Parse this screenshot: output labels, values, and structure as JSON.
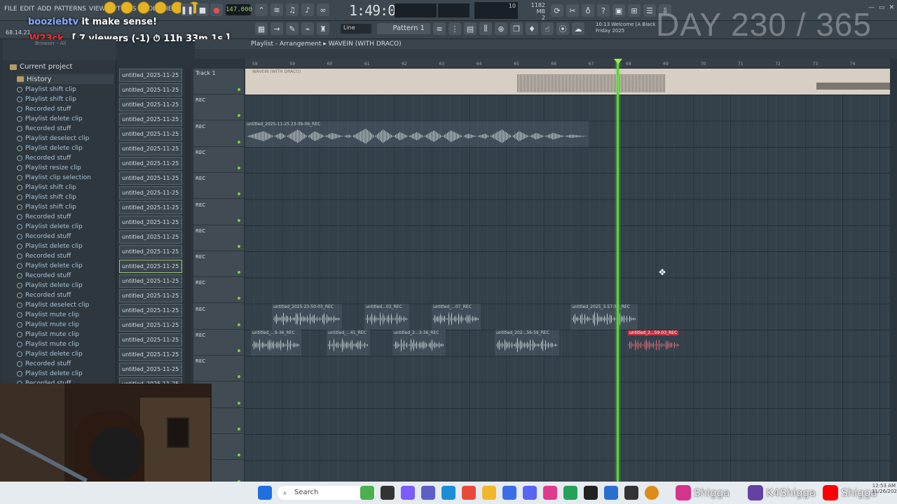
{
  "menu": [
    "FILE",
    "EDIT",
    "ADD",
    "PATTERNS",
    "VIEW",
    "OPTIONS",
    "TOOLS",
    "HELP"
  ],
  "tempo": "147.000",
  "song_time": "1:49:02",
  "cpu": {
    "value": "10",
    "poly": "2"
  },
  "memory": {
    "mb": "1182 MB",
    "poly": "2"
  },
  "hint_bar": {
    "time": "10:13",
    "text": "Welcome [A Black",
    "day": "Friday 2025"
  },
  "day_overlay": "DAY 230 / 365",
  "chat": [
    {
      "user": "booziebtv",
      "message": "it make sense!"
    },
    {
      "user": "W23ck",
      "message": "【 7 viewers (-1) ⏱ 11h 33m 1s 】"
    }
  ],
  "timestamp": "68.14.21",
  "toolbar2": {
    "snap": "Line",
    "pattern": "Pattern 1"
  },
  "browser": {
    "label": "Browser - All",
    "current_project": "Current project",
    "history_label": "History",
    "history": [
      "Playlist shift clip",
      "Playlist shift clip",
      "Recorded stuff",
      "Playlist delete clip",
      "Recorded stuff",
      "Playlist deselect clip",
      "Playlist delete clip",
      "Recorded stuff",
      "Playlist resize clip",
      "Playlist clip selection",
      "Playlist shift clip",
      "Playlist shift clip",
      "Playlist shift clip",
      "Recorded stuff",
      "Playlist delete clip",
      "Recorded stuff",
      "Playlist delete clip",
      "Recorded stuff",
      "Playlist delete clip",
      "Recorded stuff",
      "Playlist delete clip",
      "Recorded stuff",
      "Playlist deselect clip",
      "Playlist mute clip",
      "Playlist mute clip",
      "Playlist mute clip",
      "Playlist mute clip",
      "Playlist delete clip",
      "Recorded stuff",
      "Playlist delete clip",
      "Recorded stuff"
    ]
  },
  "clip_list": {
    "items": [
      "untitled_2025-11-25 23-",
      "untitled_2025-11-25 23-",
      "untitled_2025-11-25 23-",
      "untitled_2025-11-25 23-",
      "untitled_2025-11-25 23-",
      "untitled_2025-11-25 23-",
      "untitled_2025-11-25 23-",
      "untitled_2025-11-25 23-",
      "untitled_2025-11-25 23-",
      "untitled_2025-11-25 23-",
      "untitled_2025-11-25 23-",
      "untitled_2025-11-25 23-",
      "untitled_2025-11-25 23-",
      "untitled_2025-11-25 23-",
      "untitled_2025-11-25 23-",
      "untitled_2025-11-25 23-",
      "untitled_2025-11-25 23-",
      "untitled_2025-11-25 23-",
      "untitled_2025-11-25 23-",
      "untitled_2025-11-25 23-",
      "untitled_2025-11-25 23-",
      "untitled_2025-11-25 23-",
      "untitled_2025-11-25 23-"
    ],
    "selected_index": 13
  },
  "playlist": {
    "title": "Playlist - Arrangement",
    "arrangement": "WAVEIN (WITH DRACO)",
    "timeline": [
      "58",
      "59",
      "60",
      "61",
      "62",
      "63",
      "64",
      "65",
      "66",
      "67",
      "68",
      "69",
      "70",
      "71",
      "72",
      "73",
      "74"
    ],
    "tracks": [
      "Track 1",
      "REC",
      "REC",
      "REC",
      "REC",
      "REC",
      "REC",
      "REC",
      "REC",
      "REC",
      "REC",
      "REC",
      "REC",
      "REC",
      "REC",
      "REC"
    ],
    "master_clip_label": "WAVEIN (WITH DRACO)",
    "clips": [
      {
        "row": 2,
        "label": "untitled_2025-11-25 23-39-06_REC"
      },
      {
        "row": 9,
        "label": "untitled_2025-23-50-03_REC"
      },
      {
        "row": 9,
        "label": "untitled...03_REC"
      },
      {
        "row": 9,
        "label": "untitled_...07_REC"
      },
      {
        "row": 9,
        "label": "untitled_2025_3-57-53_REC"
      },
      {
        "row": 10,
        "label": "untitled_...9-36_REC"
      },
      {
        "row": 10,
        "label": "untitled_...41_REC"
      },
      {
        "row": 10,
        "label": "untitled_2...3-36_REC"
      },
      {
        "row": 10,
        "label": "untitled_202...56-59_REC"
      },
      {
        "row": 10,
        "label": "untitled_2...59-03_REC",
        "selected": true
      }
    ]
  },
  "taskbar": {
    "search_placeholder": "Search",
    "clock": "12:53 AM",
    "date": "11/26/2025"
  },
  "socials": [
    {
      "platform": "instagram-icon",
      "handle": "Shigga"
    },
    {
      "platform": "twitch-icon",
      "handle": "K4Shigga"
    },
    {
      "platform": "youtube-icon",
      "handle": "Shigga"
    }
  ],
  "colors": {
    "playhead": "#5fd43a",
    "selected_clip": "#c43444",
    "accent_led": "#7fd13b"
  }
}
